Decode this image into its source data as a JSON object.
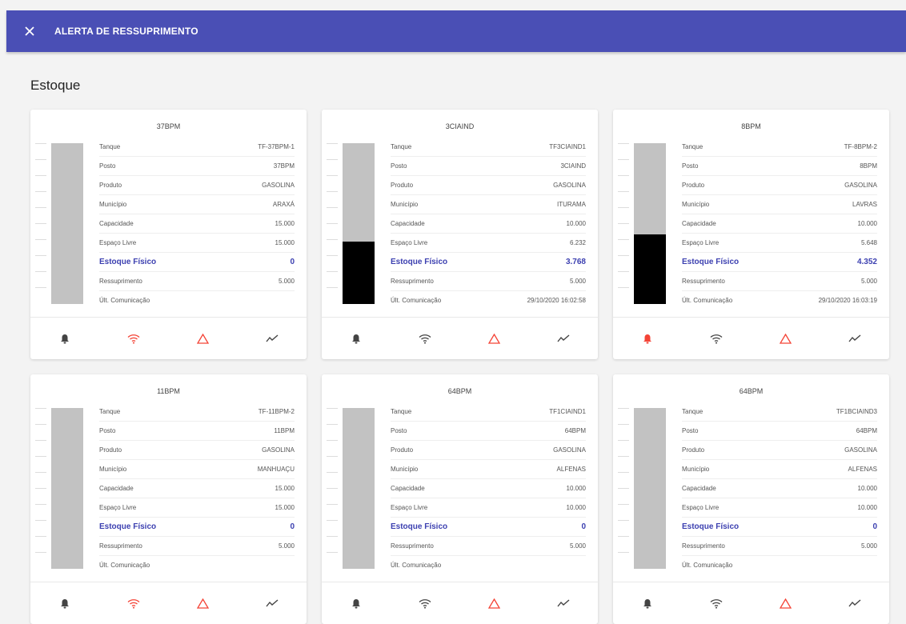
{
  "header": {
    "title": "ALERTA DE RESSUPRIMENTO"
  },
  "section": {
    "title": "Estoque"
  },
  "labels": {
    "tanque": "Tanque",
    "posto": "Posto",
    "produto": "Produto",
    "municipio": "Município",
    "capacidade": "Capacidade",
    "espaco": "Espaço Livre",
    "estoque": "Estoque Físico",
    "ressup": "Ressuprimento",
    "comunic": "Últ. Comunicação"
  },
  "colors": {
    "accent": "#4a4fb5",
    "alert": "#f44336",
    "neutral": "#444444"
  },
  "cards": [
    {
      "title": "37BPM",
      "fill": 0.0,
      "values": {
        "tanque": "TF-37BPM-1",
        "posto": "37BPM",
        "produto": "GASOLINA",
        "municipio": "ARAXÁ",
        "capacidade": "15.000",
        "espaco": "15.000",
        "estoque": "0",
        "ressup": "5.000",
        "comunic": ""
      },
      "icons": {
        "bell": "neutral",
        "wifi": "alert",
        "warning": "alert",
        "chart": "neutral"
      }
    },
    {
      "title": "3CIAIND",
      "fill": 0.388,
      "values": {
        "tanque": "TF3CIAIND1",
        "posto": "3CIAIND",
        "produto": "GASOLINA",
        "municipio": "ITURAMA",
        "capacidade": "10.000",
        "espaco": "6.232",
        "estoque": "3.768",
        "ressup": "5.000",
        "comunic": "29/10/2020 16:02:58"
      },
      "icons": {
        "bell": "neutral",
        "wifi": "neutral",
        "warning": "alert",
        "chart": "neutral"
      }
    },
    {
      "title": "8BPM",
      "fill": 0.435,
      "values": {
        "tanque": "TF-8BPM-2",
        "posto": "8BPM",
        "produto": "GASOLINA",
        "municipio": "LAVRAS",
        "capacidade": "10.000",
        "espaco": "5.648",
        "estoque": "4.352",
        "ressup": "5.000",
        "comunic": "29/10/2020 16:03:19"
      },
      "icons": {
        "bell": "alert",
        "wifi": "neutral",
        "warning": "alert",
        "chart": "neutral"
      }
    },
    {
      "title": "11BPM",
      "fill": 0.0,
      "values": {
        "tanque": "TF-11BPM-2",
        "posto": "11BPM",
        "produto": "GASOLINA",
        "municipio": "MANHUAÇU",
        "capacidade": "15.000",
        "espaco": "15.000",
        "estoque": "0",
        "ressup": "5.000",
        "comunic": ""
      },
      "icons": {
        "bell": "neutral",
        "wifi": "alert",
        "warning": "alert",
        "chart": "neutral"
      }
    },
    {
      "title": "64BPM",
      "fill": 0.0,
      "values": {
        "tanque": "TF1CIAIND1",
        "posto": "64BPM",
        "produto": "GASOLINA",
        "municipio": "ALFENAS",
        "capacidade": "10.000",
        "espaco": "10.000",
        "estoque": "0",
        "ressup": "5.000",
        "comunic": ""
      },
      "icons": {
        "bell": "neutral",
        "wifi": "neutral",
        "warning": "alert",
        "chart": "neutral"
      }
    },
    {
      "title": "64BPM",
      "fill": 0.0,
      "values": {
        "tanque": "TF1BCIAIND3",
        "posto": "64BPM",
        "produto": "GASOLINA",
        "municipio": "ALFENAS",
        "capacidade": "10.000",
        "espaco": "10.000",
        "estoque": "0",
        "ressup": "5.000",
        "comunic": ""
      },
      "icons": {
        "bell": "neutral",
        "wifi": "neutral",
        "warning": "alert",
        "chart": "neutral"
      }
    }
  ]
}
